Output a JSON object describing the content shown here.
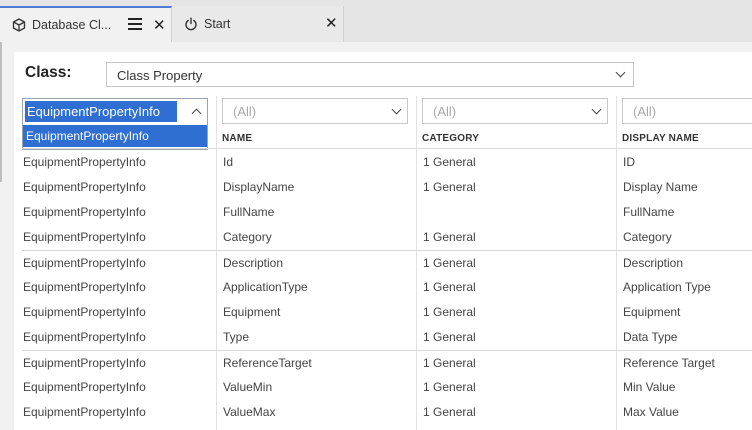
{
  "tabs": [
    {
      "label": "Database Cl...",
      "icon": "cube-icon"
    },
    {
      "label": "Start",
      "icon": "power-icon"
    }
  ],
  "class_selector": {
    "label": "Class:",
    "value": "Class Property"
  },
  "filters": {
    "owner": {
      "value": "EquipmentPropertyInfo",
      "options": [
        "EquipmentPropertyInfo"
      ]
    },
    "name": {
      "placeholder": "(All)"
    },
    "category": {
      "placeholder": "(All)"
    },
    "display_name": {
      "placeholder": "(All)"
    }
  },
  "columns": [
    "NAME",
    "CATEGORY",
    "DISPLAY NAME"
  ],
  "rows": [
    {
      "owner": "EquipmentPropertyInfo",
      "name": "Id",
      "category": "1 General",
      "display_name": "ID"
    },
    {
      "owner": "EquipmentPropertyInfo",
      "name": "DisplayName",
      "category": "1 General",
      "display_name": "Display Name"
    },
    {
      "owner": "EquipmentPropertyInfo",
      "name": "FullName",
      "category": "",
      "display_name": "FullName"
    },
    {
      "owner": "EquipmentPropertyInfo",
      "name": "Category",
      "category": "1 General",
      "display_name": "Category"
    },
    {
      "owner": "EquipmentPropertyInfo",
      "name": "Description",
      "category": "1 General",
      "display_name": "Description"
    },
    {
      "owner": "EquipmentPropertyInfo",
      "name": "ApplicationType",
      "category": "1 General",
      "display_name": "Application Type"
    },
    {
      "owner": "EquipmentPropertyInfo",
      "name": "Equipment",
      "category": "1 General",
      "display_name": "Equipment"
    },
    {
      "owner": "EquipmentPropertyInfo",
      "name": "Type",
      "category": "1 General",
      "display_name": "Data Type"
    },
    {
      "owner": "EquipmentPropertyInfo",
      "name": "ReferenceTarget",
      "category": "1 General",
      "display_name": "Reference Target"
    },
    {
      "owner": "EquipmentPropertyInfo",
      "name": "ValueMin",
      "category": "1 General",
      "display_name": "Min Value"
    },
    {
      "owner": "EquipmentPropertyInfo",
      "name": "ValueMax",
      "category": "1 General",
      "display_name": "Max Value"
    }
  ],
  "colors": {
    "accent": "#2f6fd1",
    "tab_indicator": "#4f7ad6"
  }
}
